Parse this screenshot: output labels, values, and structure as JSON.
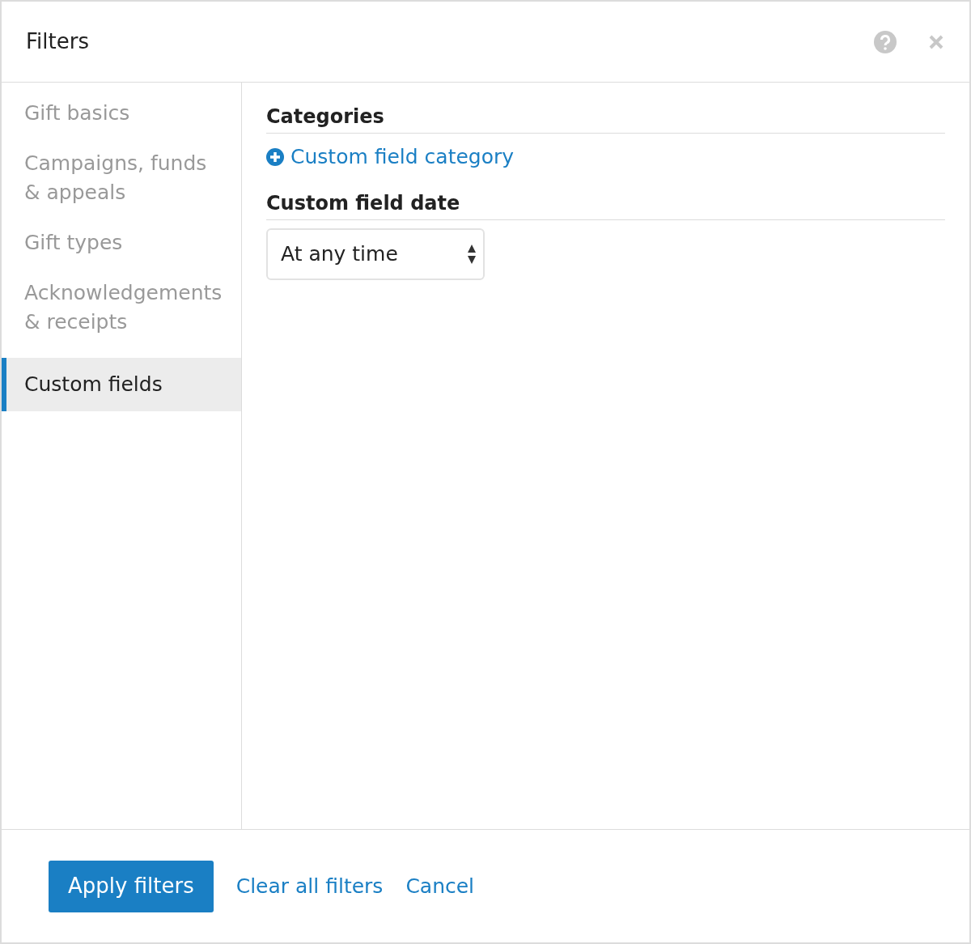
{
  "dialog": {
    "title": "Filters"
  },
  "sidebar": {
    "items": [
      {
        "label": "Gift basics",
        "selected": false
      },
      {
        "label": "Campaigns, funds & appeals",
        "selected": false
      },
      {
        "label": "Gift types",
        "selected": false
      },
      {
        "label": "Acknowledgements & receipts",
        "selected": false
      },
      {
        "label": "Custom fields",
        "selected": true
      }
    ]
  },
  "sections": [
    {
      "kind": "link",
      "heading": "Categories",
      "link": "Custom field category"
    },
    {
      "kind": "select",
      "heading": "Custom field date",
      "value": "At any time"
    }
  ],
  "footer": {
    "primary": "Apply filters",
    "links": [
      "Clear all filters",
      "Cancel"
    ]
  }
}
